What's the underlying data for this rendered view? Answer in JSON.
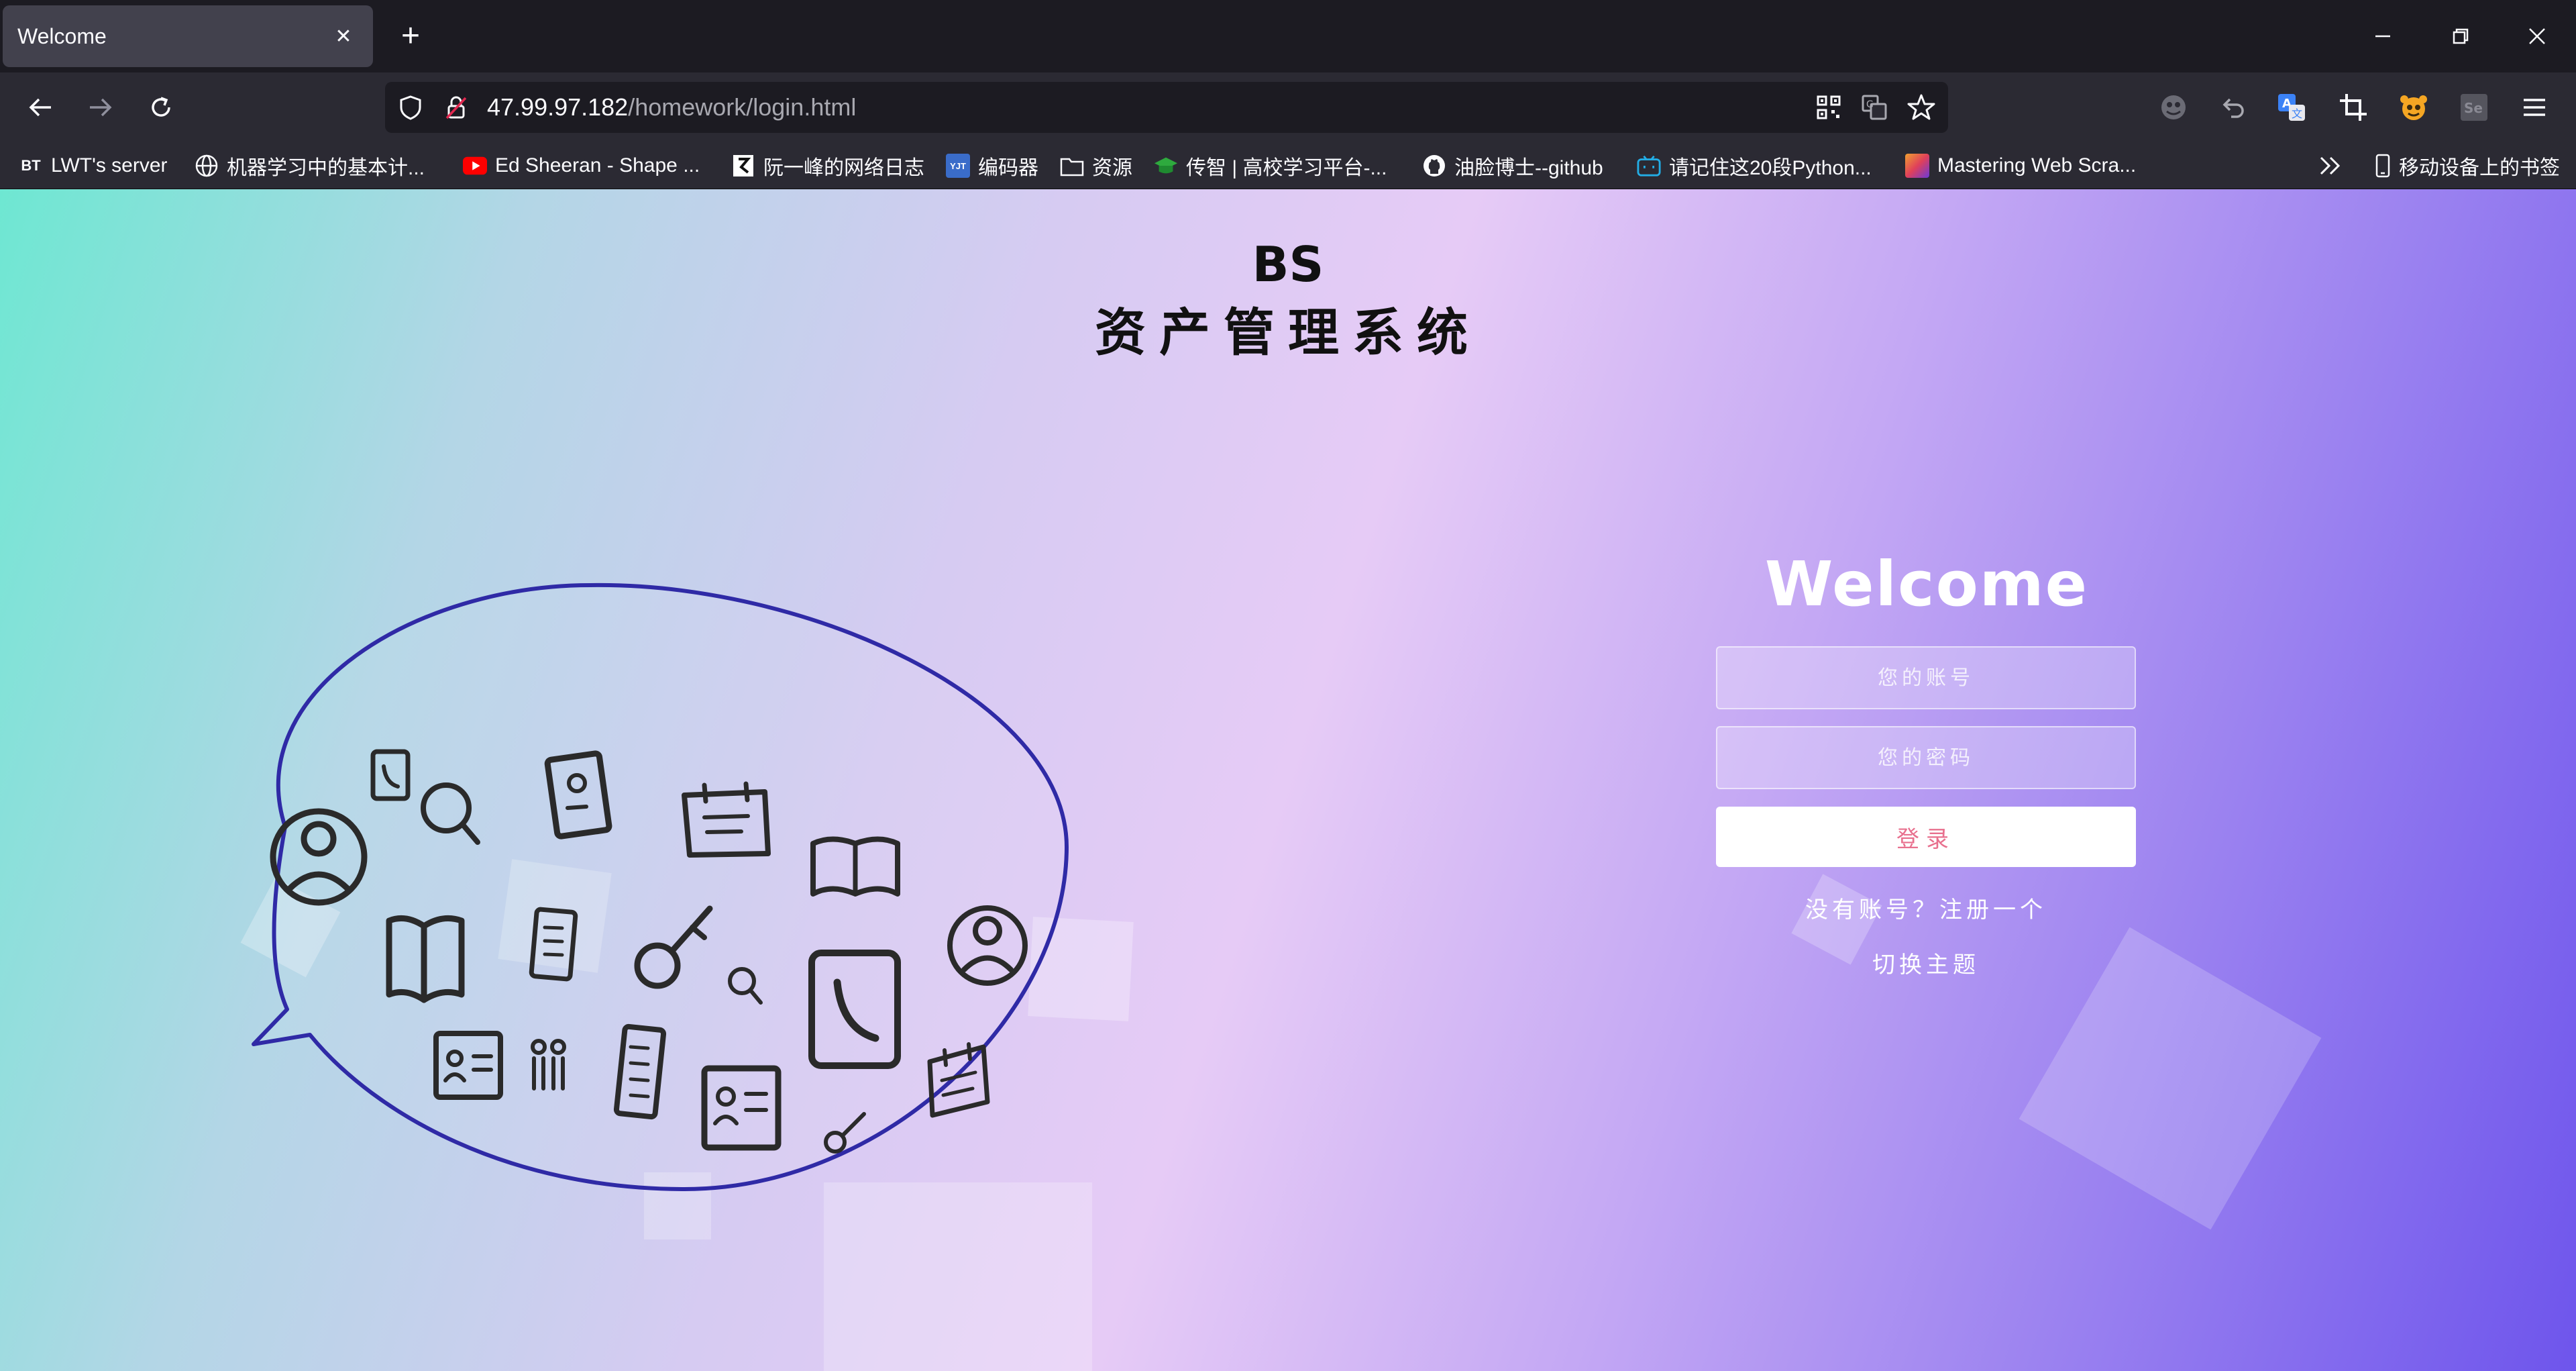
{
  "browser": {
    "tab_title": "Welcome",
    "tab_close_glyph": "✕",
    "new_tab_glyph": "+",
    "url_host": "47.99.97.182",
    "url_path": "/homework/login.html",
    "bookmarks": [
      {
        "label": "LWT's server",
        "icon": "BT",
        "icon_color": "#2b2a33"
      },
      {
        "label": "机器学习中的基本计...",
        "icon": "globe-icon",
        "icon_color": "#2b2a33"
      },
      {
        "label": "Ed Sheeran - Shape ...",
        "icon": "youtube-icon",
        "icon_color": "#ff0000"
      },
      {
        "label": "阮一峰的网络日志",
        "icon": "ruanyifeng-icon",
        "icon_color": "#ffffff"
      },
      {
        "label": "编码器",
        "icon": "YJT",
        "icon_color": "#3a6cc9"
      },
      {
        "label": "资源",
        "icon": "folder-icon",
        "icon_color": "#2b2a33"
      },
      {
        "label": "传智 | 高校学习平台-...",
        "icon": "graduation-cap-icon",
        "icon_color": "#2eaa3e"
      },
      {
        "label": "油脸博士--github",
        "icon": "github-icon",
        "icon_color": "#2b2a33"
      },
      {
        "label": "请记住这20段Python...",
        "icon": "bilibili-icon",
        "icon_color": "#23ade5"
      },
      {
        "label": "Mastering Web Scra...",
        "icon": "gradient-icon",
        "icon_color": "#e0405a"
      }
    ],
    "mobile_bookmarks": "移动设备上的书签"
  },
  "page": {
    "title_line1": "BS",
    "title_line2": "资产管理系统",
    "welcome": "Welcome",
    "account_placeholder": "您的账号",
    "password_placeholder": "您的密码",
    "login_label": "登录",
    "register_link": "没有账号？注册一个",
    "theme_link": "切换主题"
  },
  "colors": {
    "accent_login_text": "#e8708e",
    "bubble_outline": "#2f2aa6",
    "icon_stroke": "#2a2a2a"
  }
}
